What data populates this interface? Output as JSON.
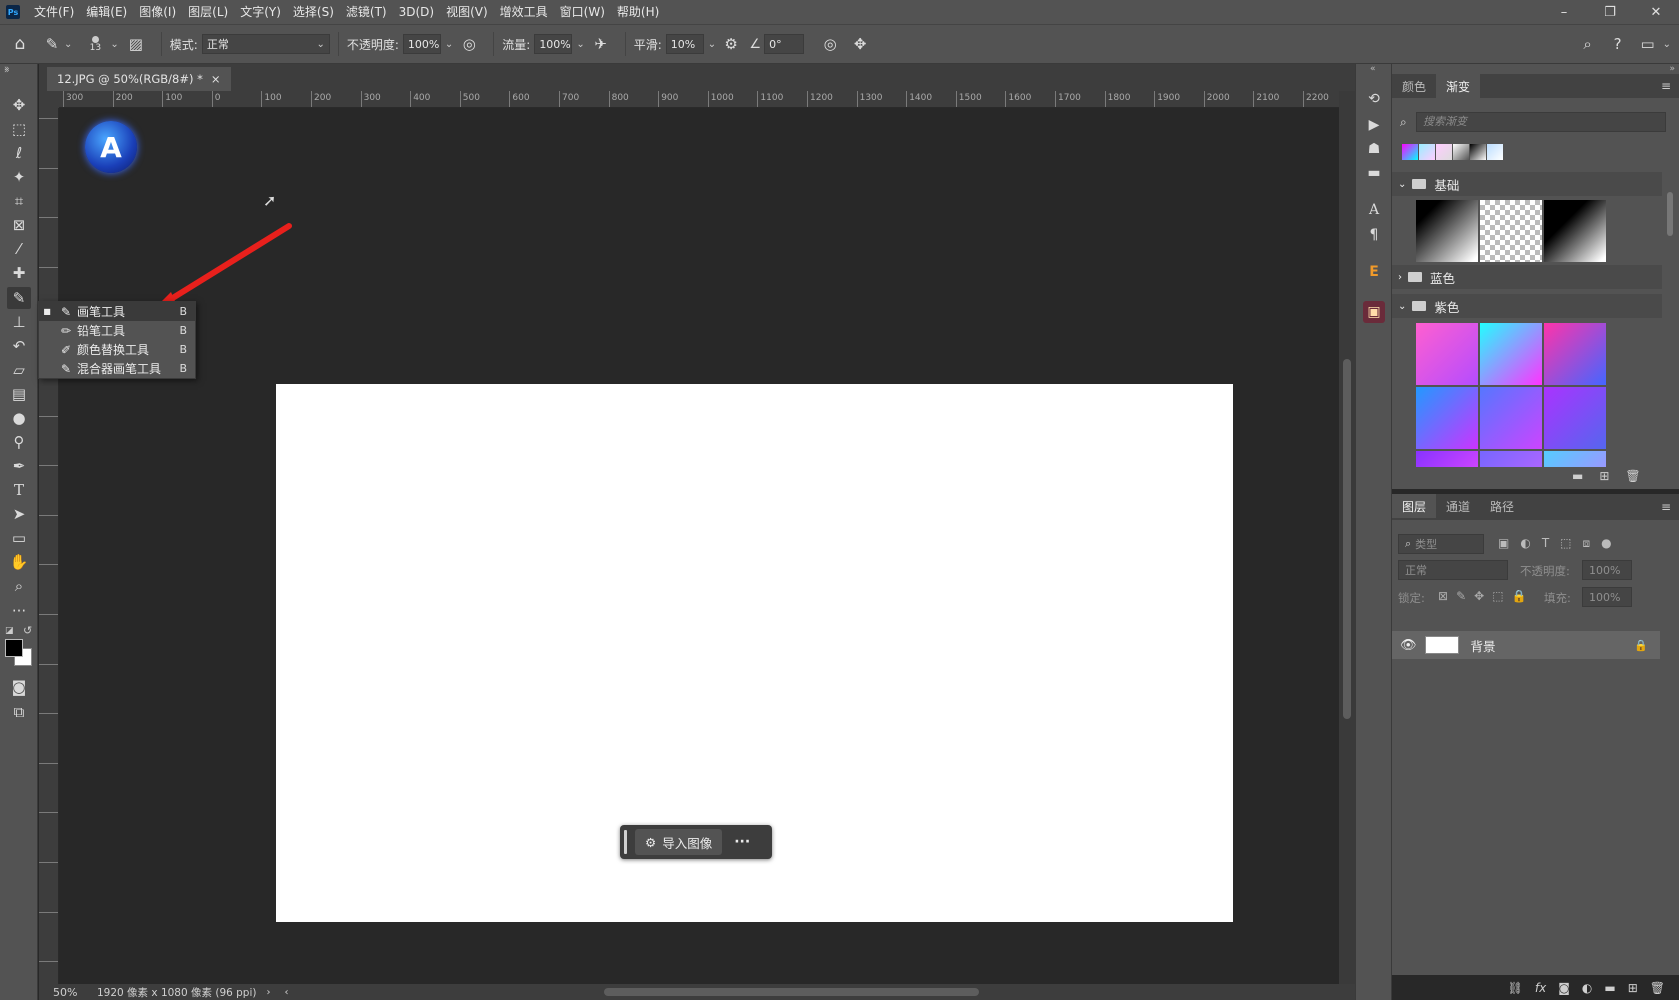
{
  "menu": {
    "logo": "Ps",
    "items": [
      "文件(F)",
      "编辑(E)",
      "图像(I)",
      "图层(L)",
      "文字(Y)",
      "选择(S)",
      "滤镜(T)",
      "3D(D)",
      "视图(V)",
      "增效工具",
      "窗口(W)",
      "帮助(H)"
    ]
  },
  "window_controls": {
    "minimize": "–",
    "restore": "❐",
    "close": "✕"
  },
  "options": {
    "brush_size": "13",
    "mode_label": "模式:",
    "mode_value": "正常",
    "opacity_label": "不透明度:",
    "opacity_value": "100%",
    "flow_label": "流量:",
    "flow_value": "100%",
    "smooth_label": "平滑:",
    "smooth_value": "10%",
    "angle_value": "0°"
  },
  "document": {
    "tab_title": "12.JPG @ 50%(RGB/8#) *",
    "tab_close": "×",
    "zoom": "50%",
    "info": "1920 像素 x 1080 像素 (96 ppi)"
  },
  "ruler_h": [
    "300",
    "200",
    "100",
    "0",
    "100",
    "200",
    "300",
    "400",
    "500",
    "600",
    "700",
    "800",
    "900",
    "1000",
    "1100",
    "1200",
    "1300",
    "1400",
    "1500",
    "1600",
    "1700",
    "1800",
    "1900",
    "2000",
    "2100",
    "2200"
  ],
  "flyout": {
    "items": [
      {
        "label": "画笔工具",
        "key": "B",
        "icon": "brush-icon",
        "selected": true
      },
      {
        "label": "铅笔工具",
        "key": "B",
        "icon": "pencil-icon",
        "selected": false
      },
      {
        "label": "颜色替换工具",
        "key": "B",
        "icon": "color-replace-icon",
        "selected": false
      },
      {
        "label": "混合器画笔工具",
        "key": "B",
        "icon": "mixer-brush-icon",
        "selected": false
      }
    ]
  },
  "context_bar": {
    "import_label": "导入图像",
    "more": "···"
  },
  "gradients_panel": {
    "tabs": [
      "颜色",
      "渐变"
    ],
    "active_tab": "渐变",
    "search_placeholder": "搜索渐变",
    "groups": [
      {
        "name": "基础",
        "expanded": true
      },
      {
        "name": "蓝色",
        "expanded": false
      },
      {
        "name": "紫色",
        "expanded": true
      }
    ]
  },
  "layers_panel": {
    "tabs": [
      "图层",
      "通道",
      "路径"
    ],
    "active_tab": "图层",
    "filter_placeholder": "类型",
    "blend_mode": "正常",
    "opacity_label": "不透明度:",
    "opacity_value": "100%",
    "lock_label": "锁定:",
    "fill_label": "填充:",
    "fill_value": "100%",
    "layers": [
      {
        "name": "背景",
        "visible": true,
        "locked": true
      }
    ]
  },
  "colors": {
    "accent_arrow": "#e8201c",
    "foreground": "#000000",
    "background": "#ffffff"
  }
}
